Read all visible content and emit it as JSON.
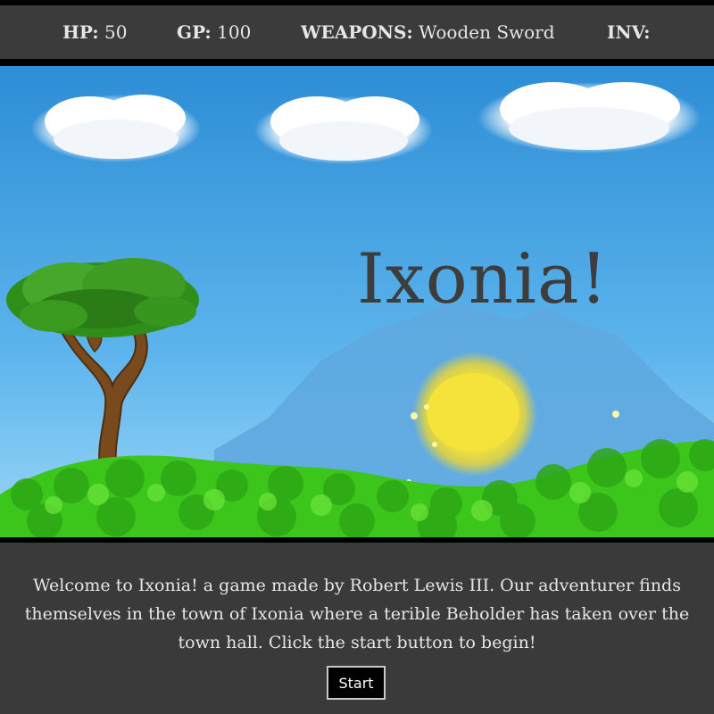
{
  "stats": {
    "hp_label": "HP:",
    "hp_value": "50",
    "gp_label": "GP:",
    "gp_value": "100",
    "weapons_label": "WEAPONS:",
    "weapons_value": "Wooden Sword",
    "inv_label": "INV:",
    "inv_value": ""
  },
  "scene": {
    "title": "Ixonia!"
  },
  "intro": {
    "text": "Welcome to Ixonia! a game made by Robert Lewis III. Our adventurer finds themselves in the town of Ixonia where a terible Beholder has taken over the town hall. Click the start button to begin!",
    "start_label": "Start"
  },
  "colors": {
    "panel": "#3b3b3b",
    "sky_top": "#2e8fd6",
    "sky_bottom": "#8fd0f5",
    "grass": "#3cc61c",
    "sun": "#f4e03a"
  }
}
